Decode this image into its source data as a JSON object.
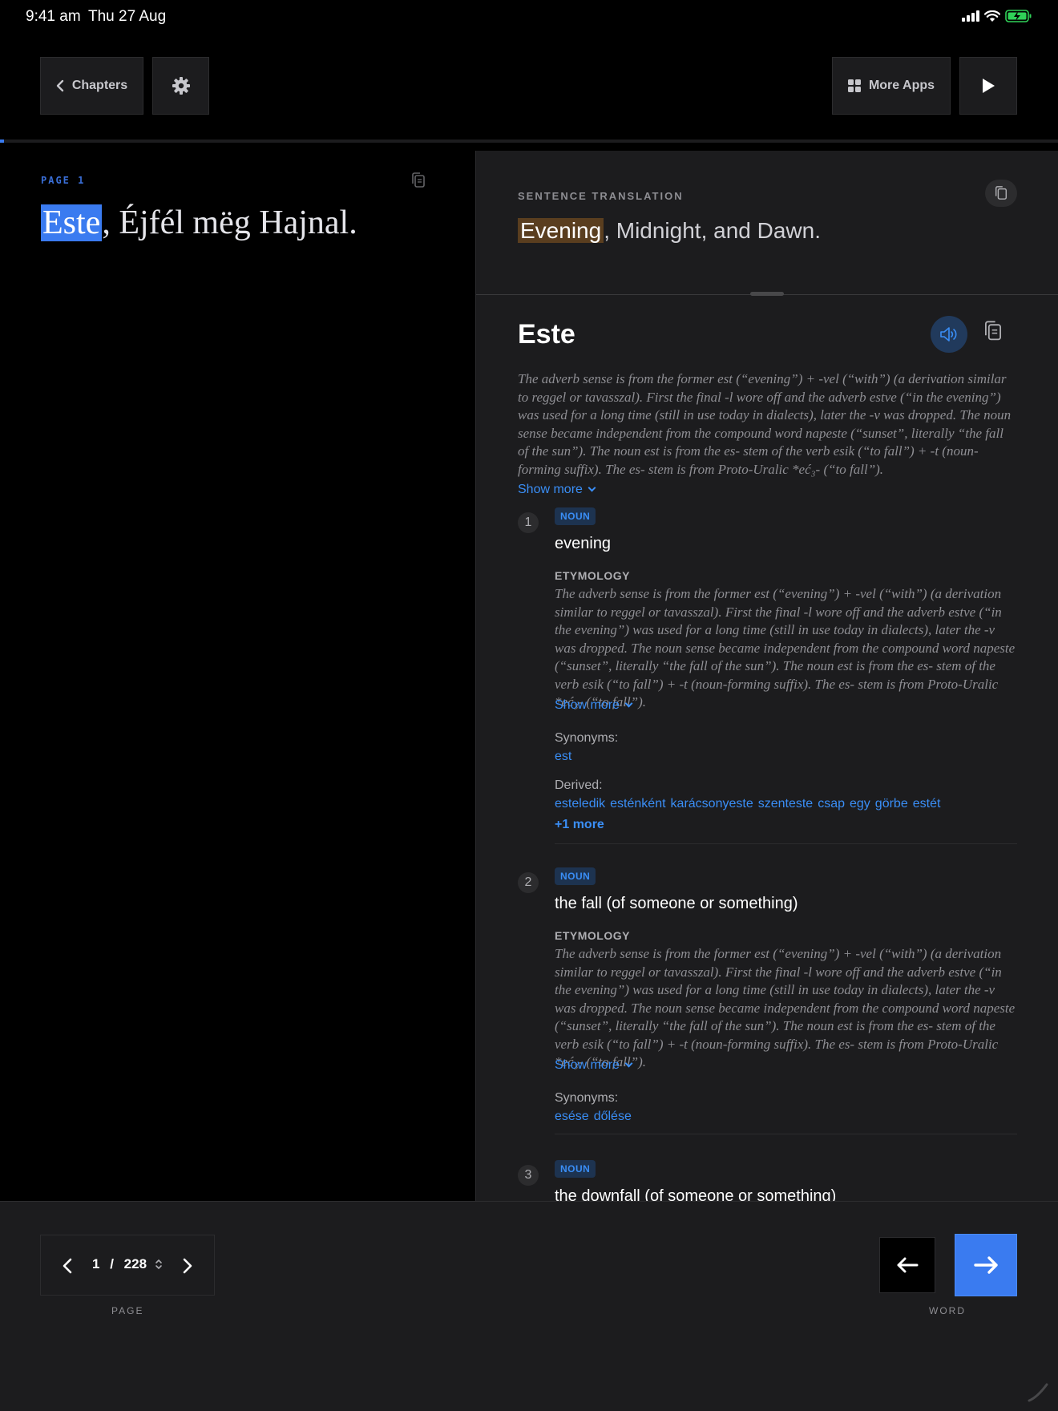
{
  "status": {
    "time": "9:41 am",
    "date": "Thu 27 Aug"
  },
  "toolbar": {
    "chapters_label": "Chapters",
    "more_apps_label": "More Apps"
  },
  "progress": {
    "fraction": 0.004
  },
  "reader": {
    "page_label": "PAGE 1",
    "sentence_highlight": "Este",
    "sentence_rest": ", Éjfél mëg Hajnal."
  },
  "translation": {
    "label": "SENTENCE TRANSLATION",
    "highlight": "Evening",
    "rest": ", Midnight, and Dawn."
  },
  "entry": {
    "word": "Este",
    "etymology": "The adverb sense is from the former est (“evening”) + -vel (“with”) (a derivation similar to reggel or tavasszal). First the final -l wore off and the adverb estve (“in the evening”) was used for a long time (still in use today in dialects), later the -v was dropped. The noun sense became independent from the compound word napeste (“sunset”, literally “the fall of the sun”). The noun est is from the es- stem of the verb esik (“to fall”) + -t (noun-forming suffix). The es- stem is from Proto-Uralic *eć₃- (“to fall”).",
    "show_more": "Show more",
    "senses": [
      {
        "num": "1",
        "pos": "NOUN",
        "gloss": "evening",
        "ety_heading": "ETYMOLOGY",
        "ety": "The adverb sense is from the former est (“evening”) + -vel (“with”) (a derivation similar to reggel or tavasszal). First the final -l wore off and the adverb estve (“in the evening”) was used for a long time (still in use today in dialects), later the -v was dropped. The noun sense became independent from the compound word napeste (“sunset”, literally “the fall of the sun”). The noun est is from the es- stem of the verb esik (“to fall”) + -t (noun-forming suffix). The es- stem is from Proto-Uralic *eć₃- (“to fall”).",
        "show_more": "Show more",
        "synonyms_label": "Synonyms:",
        "synonyms": [
          "est"
        ],
        "derived_label": "Derived:",
        "derived": [
          "esteledik",
          "esténként",
          "karácsonyeste",
          "szenteste",
          "csap",
          "egy",
          "görbe",
          "estét"
        ],
        "more_label": "+1 more"
      },
      {
        "num": "2",
        "pos": "NOUN",
        "gloss": "the fall (of someone or something)",
        "ety_heading": "ETYMOLOGY",
        "ety": "The adverb sense is from the former est (“evening”) + -vel (“with”) (a derivation similar to reggel or tavasszal). First the final -l wore off and the adverb estve (“in the evening”) was used for a long time (still in use today in dialects), later the -v was dropped. The noun sense became independent from the compound word napeste (“sunset”, literally “the fall of the sun”). The noun est is from the es- stem of the verb esik (“to fall”) + -t (noun-forming suffix). The es- stem is from Proto-Uralic *eć₃- (“to fall”).",
        "show_more": "Show more",
        "synonyms_label": "Synonyms:",
        "synonyms": [
          "esése",
          "dőlése"
        ]
      },
      {
        "num": "3",
        "pos": "NOUN",
        "gloss": "the downfall (of someone or something)"
      }
    ]
  },
  "pager": {
    "current": "1",
    "separator": "/",
    "total": "228",
    "label": "PAGE"
  },
  "word_nav": {
    "label": "WORD"
  },
  "colors": {
    "accent": "#3a7bf0",
    "link": "#3a8ef6",
    "panel": "#1c1c1e",
    "translation_highlight": "#5a3e1f"
  }
}
